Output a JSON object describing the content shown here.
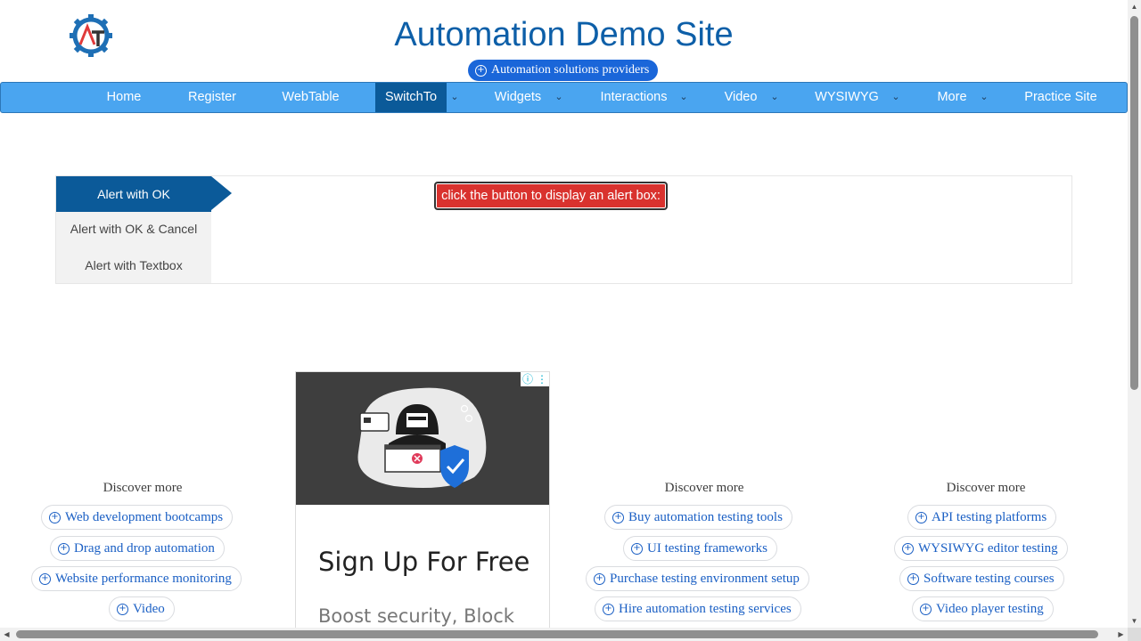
{
  "header": {
    "title": "Automation Demo Site",
    "ad_pill": "Automation solutions providers",
    "logo_icon": "gear-logo-icon"
  },
  "nav": {
    "items": [
      "Home",
      "Register",
      "WebTable",
      "SwitchTo",
      "Widgets",
      "Interactions",
      "Video",
      "WYSIWYG",
      "More",
      "Practice Site"
    ],
    "active": "SwitchTo",
    "colors": {
      "bar": "#4aa5f0",
      "active": "#0b5a99"
    }
  },
  "alerts": {
    "tabs": [
      "Alert with OK",
      "Alert with OK & Cancel",
      "Alert with Textbox"
    ],
    "active_tab": "Alert with OK",
    "button_label": "click the button to display an alert box:",
    "button_color": "#d9322e"
  },
  "discover": {
    "left": {
      "title": "Discover more",
      "links": [
        "Web development bootcamps",
        "Drag and drop automation",
        "Website performance monitoring",
        "Video"
      ]
    },
    "middle": {
      "title": "Discover more",
      "links": [
        "Buy automation testing tools",
        "UI testing frameworks",
        "Purchase testing environment setup",
        "Hire automation testing services"
      ]
    },
    "right": {
      "title": "Discover more",
      "links": [
        "API testing platforms",
        "WYSIWYG editor testing",
        "Software testing courses",
        "Video player testing"
      ]
    }
  },
  "ad": {
    "headline": "Sign Up For Free",
    "subtext": "Boost security, Block"
  }
}
